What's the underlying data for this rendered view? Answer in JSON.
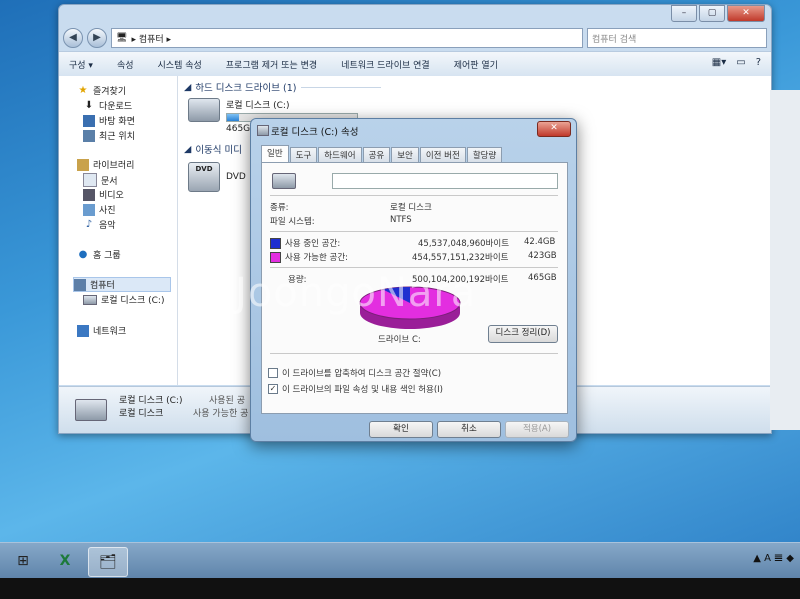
{
  "explorer": {
    "address": "▸ 컴퓨터 ▸",
    "search_placeholder": "컴퓨터 검색",
    "toolbar": [
      "구성 ▾",
      "속성",
      "시스템 속성",
      "프로그램 제거 또는 변경",
      "네트워크 드라이브 연결",
      "제어판 열기"
    ],
    "nav": {
      "favorites": "즐겨찾기",
      "downloads": "다운로드",
      "desktop": "바탕 화면",
      "recent": "최근 위치",
      "libraries": "라이브러리",
      "documents": "문서",
      "videos": "비디오",
      "pictures": "사진",
      "music": "음악",
      "homegroup": "홈 그룹",
      "computer": "컴퓨터",
      "local_disk": "로컬 디스크 (C:)",
      "network": "네트워크"
    },
    "groups": {
      "hdd": "하드 디스크 드라이브 (1)",
      "removable": "이동식 미디"
    },
    "drive_c": {
      "name": "로컬 디스크 (C:)",
      "size": "465G",
      "used_fraction": 0.09
    },
    "dvd": {
      "label": "DVD",
      "icon_text": "DVD"
    },
    "details": {
      "name": "로컬 디스크 (C:)",
      "type": "로컬 디스크",
      "used_label": "사용된 공",
      "free_label": "사용 가능한 공"
    }
  },
  "dialog": {
    "title": "로컬 디스크 (C:) 속성",
    "close": "✕",
    "tabs": [
      "일반",
      "도구",
      "하드웨어",
      "공유",
      "보안",
      "이전 버전",
      "할당량"
    ],
    "type_label": "종류:",
    "type_value": "로컬 디스크",
    "fs_label": "파일 시스템:",
    "fs_value": "NTFS",
    "used": {
      "label": "사용 중인 공간:",
      "bytes": "45,537,048,960바이트",
      "size": "42.4GB",
      "color": "#1f2fd0"
    },
    "free": {
      "label": "사용 가능한 공간:",
      "bytes": "454,557,151,232바이트",
      "size": "423GB",
      "color": "#e32ee0"
    },
    "capacity": {
      "label": "용량:",
      "bytes": "500,104,200,192바이트",
      "size": "465GB"
    },
    "drive_label": "드라이브 C:",
    "cleanup": "디스크 정리(D)",
    "check_compress": "이 드라이브를 압축하여 디스크 공간 절약(C)",
    "check_index": "이 드라이브의 파일 속성 및 내용 색인 허용(I)",
    "compress_checked": "",
    "index_checked": "✓",
    "ok": "확인",
    "cancel": "취소",
    "apply": "적용(A)",
    "used_fraction": 0.091
  },
  "watermark": "JoongoNara",
  "tray": "▲ A 𝌆 ◆"
}
